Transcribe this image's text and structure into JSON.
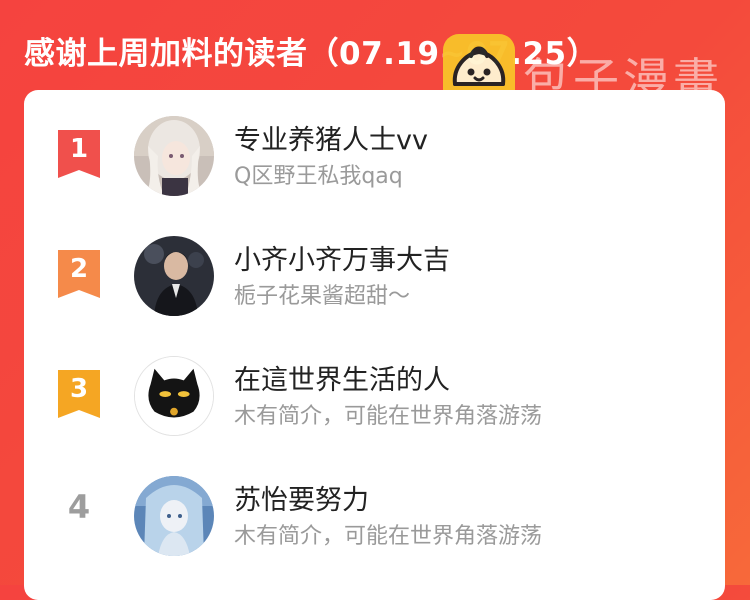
{
  "header": {
    "title": "感谢上周加料的读者（07.19~07.25）"
  },
  "watermark": {
    "text": "包子漫畫",
    "logo_color": "#f9c12a"
  },
  "colors": {
    "background": "#f5433f",
    "rank1": "#f0504c",
    "rank2": "#f58a4a",
    "rank3": "#f5a623",
    "rank_plain": "#9d9d9d"
  },
  "readers": [
    {
      "rank": "1",
      "name": "专业养猪人士vv",
      "bio": "Q区野王私我qaq",
      "avatar_icon": "anime-girl-avatar"
    },
    {
      "rank": "2",
      "name": "小齐小齐万事大吉",
      "bio": "栀子花果酱超甜～",
      "avatar_icon": "person-photo-avatar"
    },
    {
      "rank": "3",
      "name": "在這世界生活的人",
      "bio": "木有简介，可能在世界角落游荡",
      "avatar_icon": "black-cat-avatar"
    },
    {
      "rank": "4",
      "name": "苏怡要努力",
      "bio": "木有简介，可能在世界角落游荡",
      "avatar_icon": "blue-anime-avatar"
    }
  ]
}
